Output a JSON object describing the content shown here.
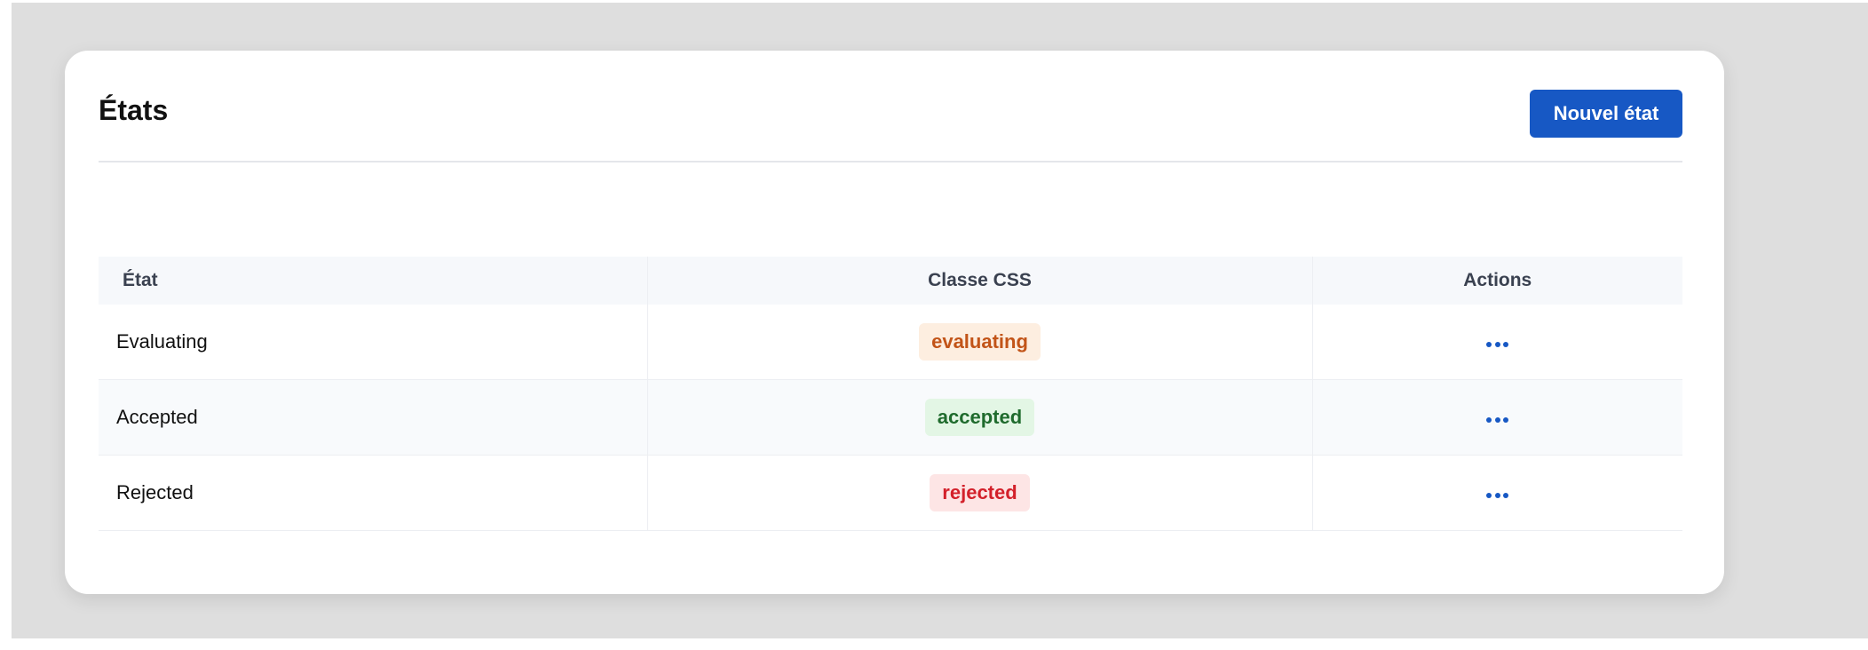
{
  "header": {
    "title": "États",
    "new_button_label": "Nouvel état"
  },
  "table": {
    "columns": {
      "state": "État",
      "css_class": "Classe CSS",
      "actions": "Actions"
    },
    "rows": [
      {
        "state": "Evaluating",
        "css_class": "evaluating",
        "badge_bg": "#fdeee0",
        "badge_fg": "#c25418"
      },
      {
        "state": "Accepted",
        "css_class": "accepted",
        "badge_bg": "#e3f6e5",
        "badge_fg": "#1f6b2d"
      },
      {
        "state": "Rejected",
        "css_class": "rejected",
        "badge_bg": "#fde5e5",
        "badge_fg": "#d3202a"
      }
    ],
    "actions_icon": "more-horizontal-icon"
  },
  "colors": {
    "accent": "#1758c4",
    "background": "#dedede",
    "card": "#ffffff"
  }
}
